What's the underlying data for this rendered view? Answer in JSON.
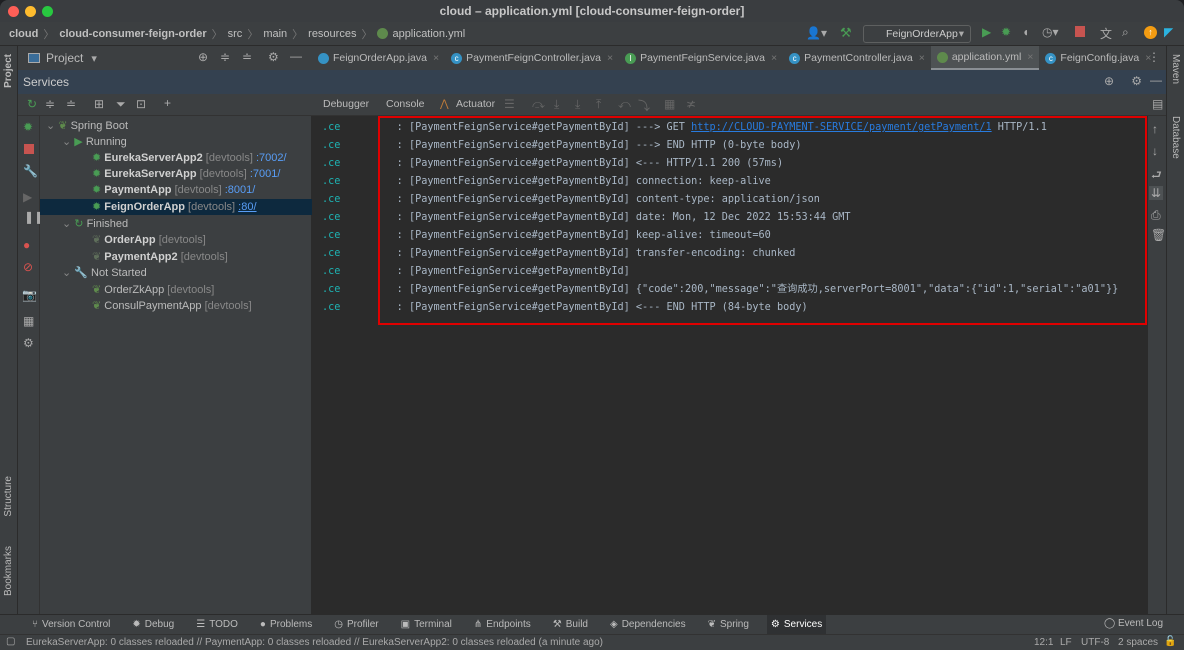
{
  "window": {
    "title": "cloud – application.yml [cloud-consumer-feign-order]"
  },
  "breadcrumb": [
    "cloud",
    "cloud-consumer-feign-order",
    "src",
    "main",
    "resources",
    "application.yml"
  ],
  "toolbar": {
    "run_config": "FeignOrderApp"
  },
  "project_panel": {
    "label": "Project"
  },
  "tabs": [
    {
      "label": "FeignOrderApp.java",
      "icon": "spring-class-icon",
      "active": false
    },
    {
      "label": "PaymentFeignController.java",
      "icon": "class-icon",
      "active": false
    },
    {
      "label": "PaymentFeignService.java",
      "icon": "interface-icon",
      "active": false
    },
    {
      "label": "PaymentController.java",
      "icon": "class-icon",
      "active": false
    },
    {
      "label": "application.yml",
      "icon": "spring-config-icon",
      "active": true
    },
    {
      "label": "FeignConfig.java",
      "icon": "class-icon",
      "active": false
    }
  ],
  "services": {
    "title": "Services",
    "subtabs": [
      "Debugger",
      "Console",
      "Actuator"
    ],
    "tree": {
      "root": "Spring Boot",
      "groups": [
        {
          "label": "Running",
          "items": [
            {
              "name": "EurekaServerApp2",
              "tag": "[devtools]",
              "port": ":7002/"
            },
            {
              "name": "EurekaServerApp",
              "tag": "[devtools]",
              "port": ":7001/"
            },
            {
              "name": "PaymentApp",
              "tag": "[devtools]",
              "port": ":8001/"
            },
            {
              "name": "FeignOrderApp",
              "tag": "[devtools]",
              "port": ":80/",
              "selected": true
            }
          ]
        },
        {
          "label": "Finished",
          "items": [
            {
              "name": "OrderApp",
              "tag": "[devtools]"
            },
            {
              "name": "PaymentApp2",
              "tag": "[devtools]"
            }
          ]
        },
        {
          "label": "Not Started",
          "items": [
            {
              "name": "OrderZkApp",
              "tag": "[devtools]"
            },
            {
              "name": "ConsulPaymentApp",
              "tag": "[devtools]"
            }
          ]
        }
      ]
    }
  },
  "console": {
    "lines": [
      {
        "src": ".ce",
        "text": "  : [PaymentFeignService#getPaymentById] ---> GET ",
        "link": "http://CLOUD-PAYMENT-SERVICE/payment/getPayment/1",
        "after": " HTTP/1.1"
      },
      {
        "src": ".ce",
        "text": "  : [PaymentFeignService#getPaymentById] ---> END HTTP (0-byte body)"
      },
      {
        "src": ".ce",
        "text": "  : [PaymentFeignService#getPaymentById] <--- HTTP/1.1 200 (57ms)"
      },
      {
        "src": ".ce",
        "text": "  : [PaymentFeignService#getPaymentById] connection: keep-alive"
      },
      {
        "src": ".ce",
        "text": "  : [PaymentFeignService#getPaymentById] content-type: application/json"
      },
      {
        "src": ".ce",
        "text": "  : [PaymentFeignService#getPaymentById] date: Mon, 12 Dec 2022 15:53:44 GMT"
      },
      {
        "src": ".ce",
        "text": "  : [PaymentFeignService#getPaymentById] keep-alive: timeout=60"
      },
      {
        "src": ".ce",
        "text": "  : [PaymentFeignService#getPaymentById] transfer-encoding: chunked"
      },
      {
        "src": ".ce",
        "text": "  : [PaymentFeignService#getPaymentById]"
      },
      {
        "src": ".ce",
        "text": "  : [PaymentFeignService#getPaymentById] {\"code\":200,\"message\":\"查询成功,serverPort=8001\",\"data\":{\"id\":1,\"serial\":\"a01\"}}"
      },
      {
        "src": ".ce",
        "text": "  : [PaymentFeignService#getPaymentById] <--- END HTTP (84-byte body)"
      }
    ]
  },
  "side_stripes": {
    "left": [
      "Project",
      "Structure",
      "Bookmarks"
    ],
    "right": [
      "Maven",
      "Database"
    ]
  },
  "bottom_tools": [
    "Version Control",
    "Debug",
    "TODO",
    "Problems",
    "Profiler",
    "Terminal",
    "Endpoints",
    "Build",
    "Dependencies",
    "Spring",
    "Services"
  ],
  "bottom_active": "Services",
  "event_log": "Event Log",
  "status": {
    "message": "EurekaServerApp: 0 classes reloaded // PaymentApp: 0 classes reloaded // EurekaServerApp2: 0 classes reloaded (a minute ago)",
    "position": "12:1",
    "line_sep": "LF",
    "encoding": "UTF-8",
    "indent": "2 spaces"
  },
  "colors": {
    "accent_link": "#287bde",
    "highlight_box": "#e00000",
    "selection": "#0d293e",
    "run_green": "#499c54"
  }
}
